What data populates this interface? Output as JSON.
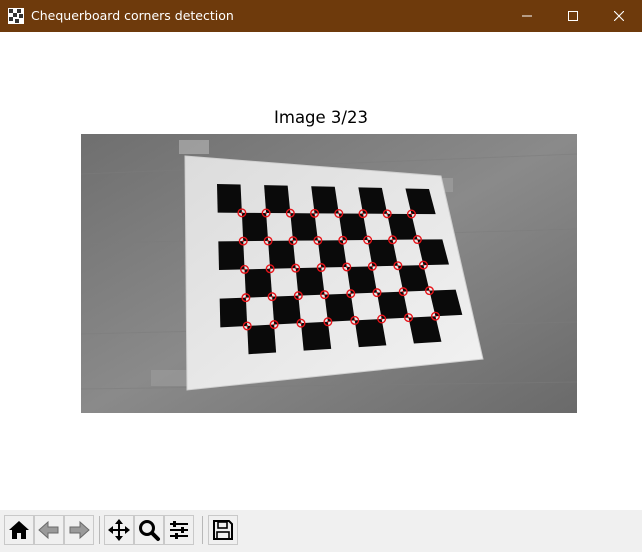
{
  "window": {
    "title": "Chequerboard corners detection",
    "titlebar_color": "#6e3a0c",
    "controls": [
      {
        "name": "minimize",
        "icon": "minimize-icon"
      },
      {
        "name": "maximize",
        "icon": "maximize-icon"
      },
      {
        "name": "close",
        "icon": "close-icon"
      }
    ]
  },
  "figure": {
    "title": "Image 3/23",
    "image_description_icon": "checkerboard-photo",
    "marker_color": "#e8141a",
    "corner_grid": {
      "rows": 5,
      "cols": 8
    }
  },
  "toolbar": {
    "buttons": [
      {
        "name": "home",
        "icon": "home-icon"
      },
      {
        "name": "back",
        "icon": "back-arrow-icon"
      },
      {
        "name": "forward",
        "icon": "forward-arrow-icon"
      },
      {
        "name": "pan",
        "icon": "move-icon"
      },
      {
        "name": "zoom",
        "icon": "magnifier-icon"
      },
      {
        "name": "configure-subplots",
        "icon": "sliders-icon"
      },
      {
        "name": "save",
        "icon": "floppy-disk-icon"
      }
    ]
  }
}
